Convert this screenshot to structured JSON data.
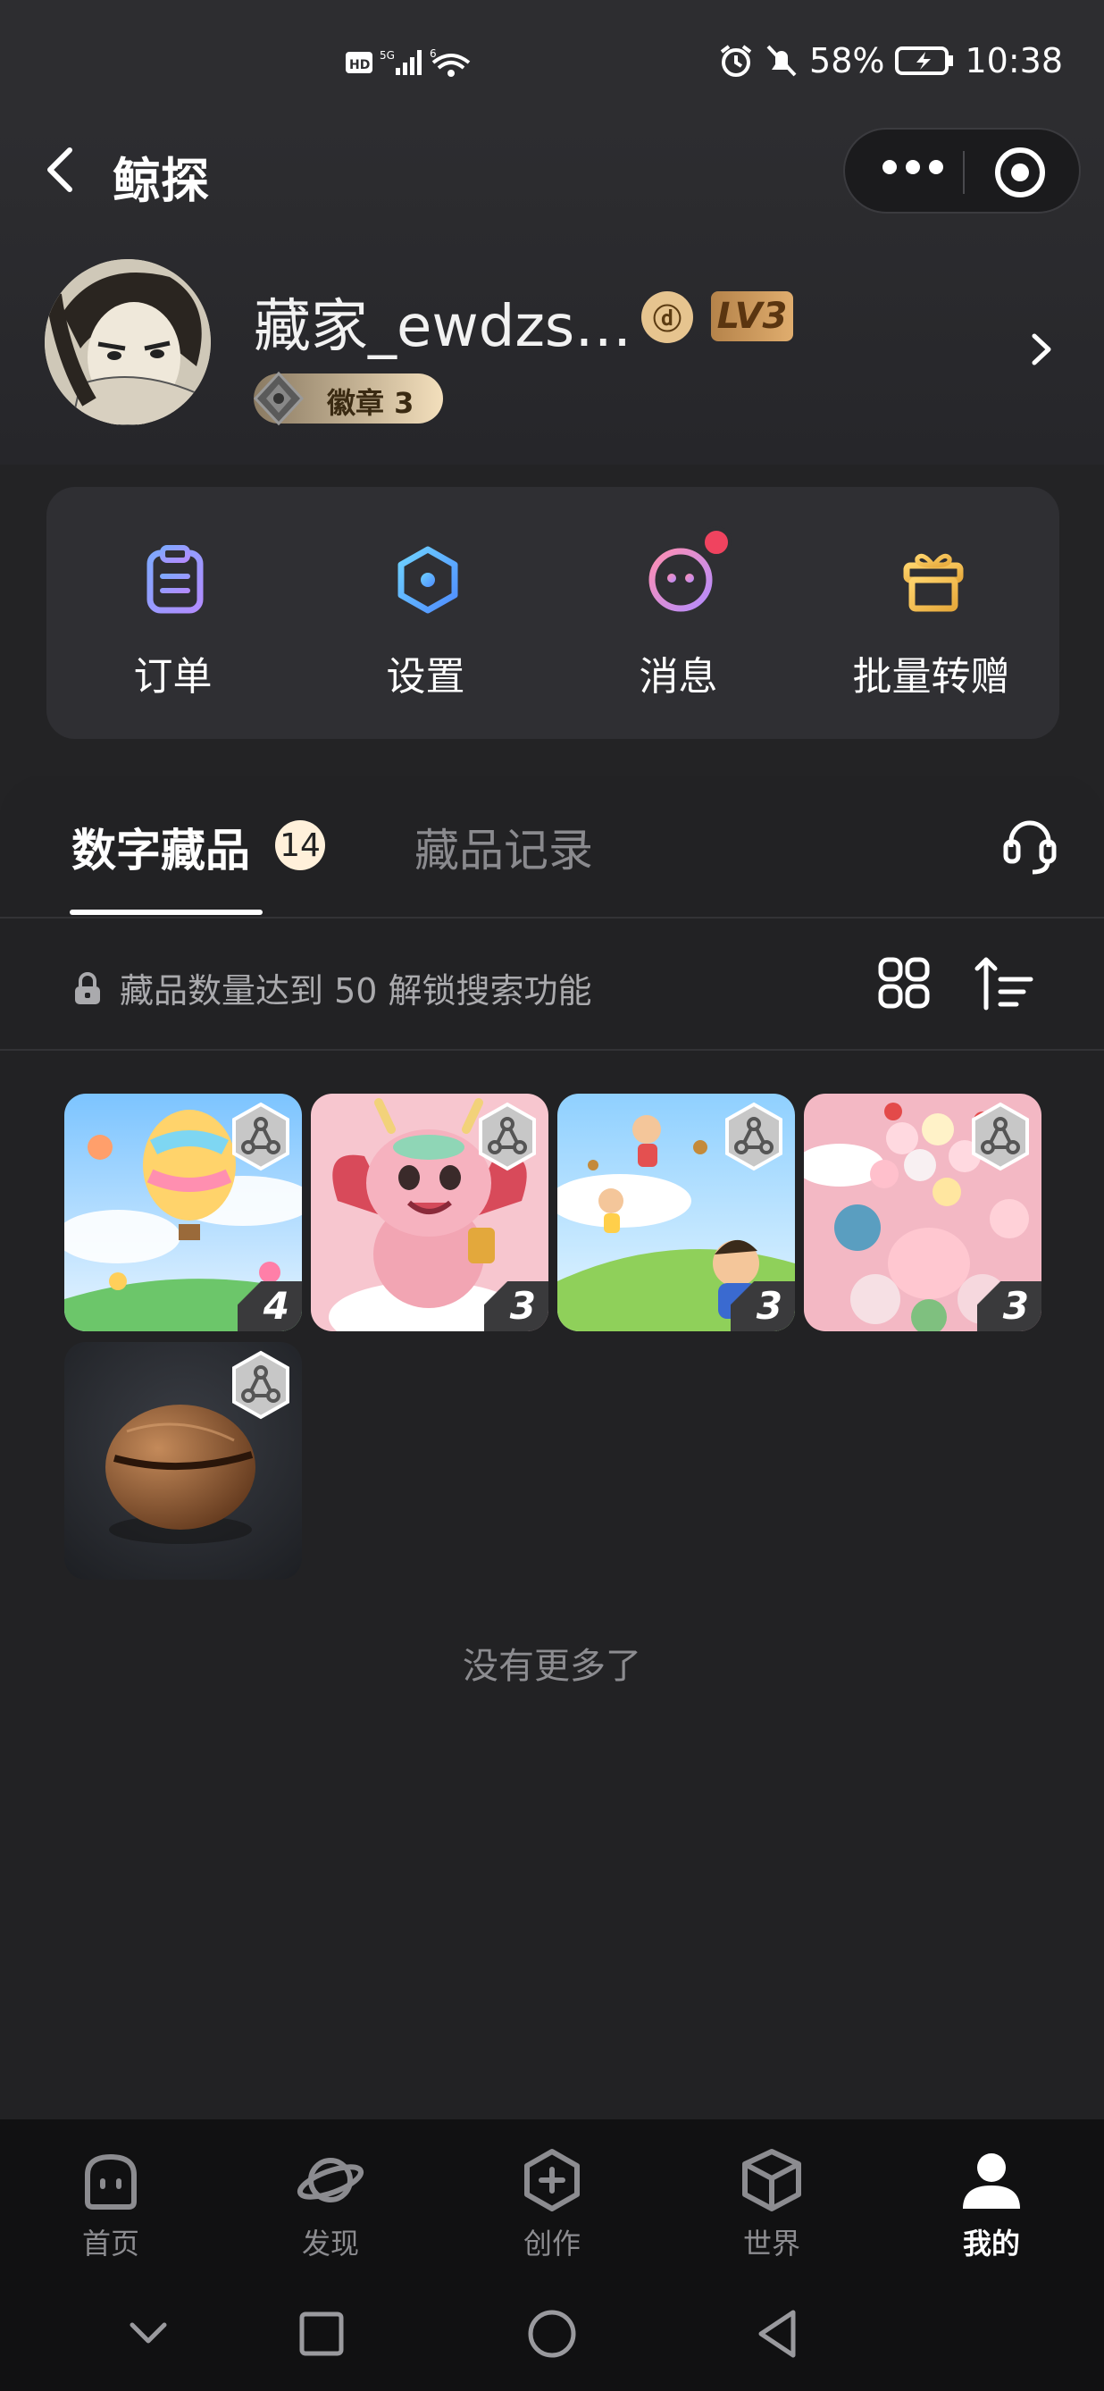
{
  "status_bar": {
    "network": "HD 5G 6",
    "battery": "58%",
    "time": "10:38"
  },
  "header": {
    "title": "鲸探"
  },
  "profile": {
    "username": "藏家_ewdzs…",
    "level": "LV3",
    "badge_label": "徽章 3"
  },
  "actions": [
    {
      "label": "订单",
      "icon": "clipboard-icon"
    },
    {
      "label": "设置",
      "icon": "hexagon-settings-icon"
    },
    {
      "label": "消息",
      "icon": "message-face-icon"
    },
    {
      "label": "批量转赠",
      "icon": "gift-icon"
    }
  ],
  "tabs": {
    "collections_label": "数字藏品",
    "collections_count": "14",
    "records_label": "藏品记录"
  },
  "notice": {
    "text": "藏品数量达到 50 解锁搜索功能"
  },
  "collectibles": [
    {
      "count": "4",
      "subject": "hot-air-balloons"
    },
    {
      "count": "3",
      "subject": "pink-dragon"
    },
    {
      "count": "3",
      "subject": "flying-children"
    },
    {
      "count": "3",
      "subject": "cute-pigs"
    },
    {
      "count": "",
      "subject": "wooden-nut"
    }
  ],
  "footer_text": "没有更多了",
  "bottom_nav": [
    {
      "label": "首页",
      "icon": "home-face-icon"
    },
    {
      "label": "发现",
      "icon": "planet-icon"
    },
    {
      "label": "创作",
      "icon": "plus-hexagon-icon"
    },
    {
      "label": "世界",
      "icon": "cube-icon"
    },
    {
      "label": "我的",
      "icon": "user-icon"
    }
  ],
  "colors": {
    "background": "#232325",
    "accent_gold": "#e0ad6e",
    "notification_red": "#f0435f"
  }
}
